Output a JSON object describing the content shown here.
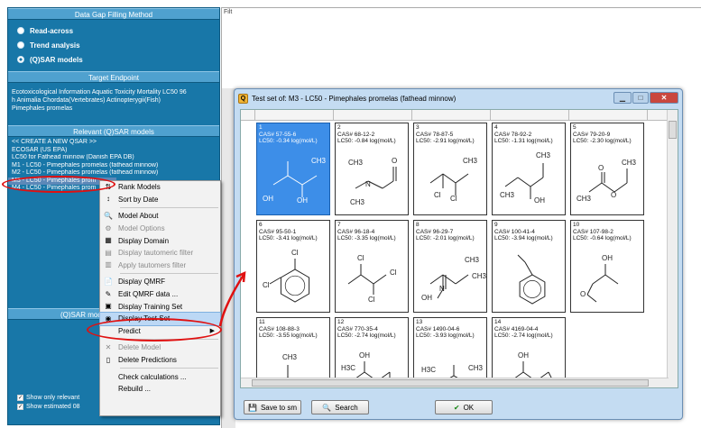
{
  "left_panel": {
    "gap_method_header": "Data Gap Filling Method",
    "methods": [
      "Read-across",
      "Trend analysis",
      "(Q)SAR models"
    ],
    "target_header": "Target Endpoint",
    "target_lines": [
      "Ecotoxicological Information Aquatic Toxicity Mortality LC50 96",
      "h Animalia Chordata(Vertebrates) Actinopterygii(Fish)",
      "Pimephales promelas"
    ],
    "relevant_header": "Relevant (Q)SAR models",
    "models": [
      "<< CREATE A NEW QSAR >>",
      "ECOSAR (US EPA)",
      "LC50 for Fathead minnow (Danish EPA DB)",
      "M1 - LC50 - Pimephales promelas (fathead minnow)",
      "M2 - LC50 - Pimephales promelas (fathead minnow)",
      "M3 - LC50 - Pimephales prom",
      "M4 - LC50 - Pimephales prom"
    ],
    "qsar_model_header": "(Q)SAR mod",
    "show_relevant": "Show only relevant",
    "show_estimated": "Show estimated 08"
  },
  "filter_label": "Filt",
  "context_menu": {
    "items": [
      {
        "label": "Rank Models",
        "icon": "rank-icon",
        "disabled": false
      },
      {
        "label": "Sort by Date",
        "icon": "sort-icon",
        "disabled": false
      },
      {
        "sep": true
      },
      {
        "label": "Model About",
        "icon": "search-icon",
        "disabled": false
      },
      {
        "label": "Model Options",
        "icon": "options-icon",
        "disabled": true
      },
      {
        "label": "Display Domain",
        "icon": "domain-icon",
        "disabled": false
      },
      {
        "label": "Display tautomeric filter",
        "icon": "filter-icon",
        "disabled": true
      },
      {
        "label": "Apply tautomers filter",
        "icon": "apply-icon",
        "disabled": true
      },
      {
        "sep": true
      },
      {
        "label": "Display QMRF",
        "icon": "document-icon",
        "disabled": false
      },
      {
        "label": "Edit QMRF data ...",
        "icon": "edit-icon",
        "disabled": false
      },
      {
        "label": "Display Training Set",
        "icon": "training-icon",
        "disabled": false
      },
      {
        "label": "Display Test Set",
        "icon": "test-set-icon",
        "disabled": false,
        "highlighted": true
      },
      {
        "label": "Predict",
        "icon": "",
        "disabled": false,
        "submenu": true
      },
      {
        "sep": true
      },
      {
        "label": "Delete Model",
        "icon": "close-icon",
        "disabled": true
      },
      {
        "label": "Delete Predictions",
        "icon": "page-icon",
        "disabled": false
      },
      {
        "sep": true
      },
      {
        "label": "Check calculations ...",
        "icon": "",
        "disabled": false
      },
      {
        "label": "Rebuild ...",
        "icon": "",
        "disabled": false
      }
    ]
  },
  "window": {
    "title": "Test set of: M3 - LC50 - Pimephales promelas (fathead minnow)",
    "buttons": {
      "save": "Save to sm",
      "search": "Search",
      "ok": "OK"
    }
  },
  "cells": [
    {
      "n": "1",
      "cas": "CAS# 57-55-6",
      "lc50": "LC50: -0.34 log(mol/L)",
      "atoms": [
        "CH3",
        "OH",
        "OH"
      ]
    },
    {
      "n": "2",
      "cas": "CAS# 68-12-2",
      "lc50": "LC50: -0.84 log(mol/L)",
      "atoms": [
        "CH3",
        "N",
        "CH3",
        "O"
      ]
    },
    {
      "n": "3",
      "cas": "CAS# 78-87-5",
      "lc50": "LC50: -2.91 log(mol/L)",
      "atoms": [
        "CH3",
        "Cl",
        "Cl"
      ]
    },
    {
      "n": "4",
      "cas": "CAS# 78-92-2",
      "lc50": "LC50: -1.31 log(mol/L)",
      "atoms": [
        "CH3",
        "CH3",
        "OH"
      ]
    },
    {
      "n": "5",
      "cas": "CAS# 79-20-9",
      "lc50": "LC50: -2.30 log(mol/L)",
      "atoms": [
        "CH3",
        "O",
        "O",
        "CH3"
      ]
    },
    {
      "n": "6",
      "cas": "CAS# 95-50-1",
      "lc50": "LC50: -3.41 log(mol/L)",
      "atoms": [
        "Cl",
        "Cl"
      ]
    },
    {
      "n": "7",
      "cas": "CAS# 96-18-4",
      "lc50": "LC50: -3.35 log(mol/L)",
      "atoms": [
        "Cl",
        "Cl",
        "Cl"
      ]
    },
    {
      "n": "8",
      "cas": "CAS# 96-29-7",
      "lc50": "LC50: -2.01 log(mol/L)",
      "atoms": [
        "CH3",
        "CH3",
        "N",
        "OH"
      ]
    },
    {
      "n": "9",
      "cas": "CAS# 100-41-4",
      "lc50": "LC50: -3.94 log(mol/L)",
      "atoms": []
    },
    {
      "n": "10",
      "cas": "CAS# 107-98-2",
      "lc50": "LC50: -0.64 log(mol/L)",
      "atoms": [
        "OH",
        "O"
      ]
    },
    {
      "n": "11",
      "cas": "CAS# 108-88-3",
      "lc50": "LC50: -3.55 log(mol/L)",
      "atoms": [
        "CH3"
      ]
    },
    {
      "n": "12",
      "cas": "CAS# 770-35-4",
      "lc50": "LC50: -2.74 log(mol/L)",
      "atoms": [
        "H3C",
        "OH",
        "O"
      ]
    },
    {
      "n": "13",
      "cas": "CAS# 1490-04-6",
      "lc50": "LC50: -3.93 log(mol/L)",
      "atoms": [
        "H3C",
        "CH3",
        "HO"
      ]
    },
    {
      "n": "14",
      "cas": "CAS# 4169-04-4",
      "lc50": "LC50: -2.74 log(mol/L)",
      "atoms": [
        "OH",
        "O"
      ]
    }
  ],
  "colors": {
    "panel": "#1877a8",
    "section": "#4fa1cf",
    "selected_cell": "#3d8ee8",
    "annotation": "#e01010"
  }
}
